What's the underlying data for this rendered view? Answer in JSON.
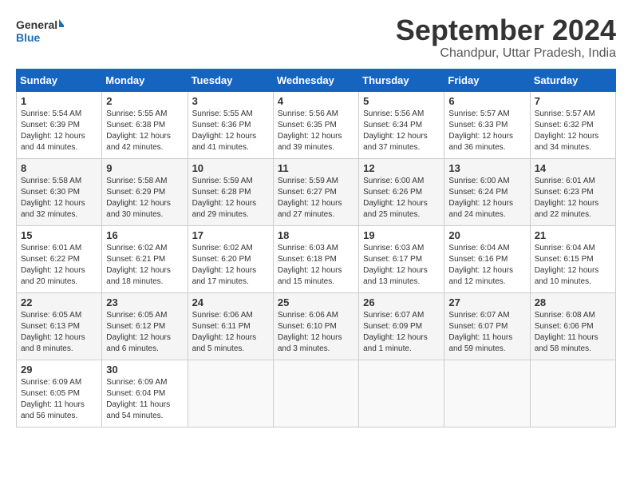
{
  "header": {
    "logo_line1": "General",
    "logo_line2": "Blue",
    "month_title": "September 2024",
    "subtitle": "Chandpur, Uttar Pradesh, India"
  },
  "weekdays": [
    "Sunday",
    "Monday",
    "Tuesday",
    "Wednesday",
    "Thursday",
    "Friday",
    "Saturday"
  ],
  "weeks": [
    [
      {
        "day": "1",
        "info": "Sunrise: 5:54 AM\nSunset: 6:39 PM\nDaylight: 12 hours\nand 44 minutes."
      },
      {
        "day": "2",
        "info": "Sunrise: 5:55 AM\nSunset: 6:38 PM\nDaylight: 12 hours\nand 42 minutes."
      },
      {
        "day": "3",
        "info": "Sunrise: 5:55 AM\nSunset: 6:36 PM\nDaylight: 12 hours\nand 41 minutes."
      },
      {
        "day": "4",
        "info": "Sunrise: 5:56 AM\nSunset: 6:35 PM\nDaylight: 12 hours\nand 39 minutes."
      },
      {
        "day": "5",
        "info": "Sunrise: 5:56 AM\nSunset: 6:34 PM\nDaylight: 12 hours\nand 37 minutes."
      },
      {
        "day": "6",
        "info": "Sunrise: 5:57 AM\nSunset: 6:33 PM\nDaylight: 12 hours\nand 36 minutes."
      },
      {
        "day": "7",
        "info": "Sunrise: 5:57 AM\nSunset: 6:32 PM\nDaylight: 12 hours\nand 34 minutes."
      }
    ],
    [
      {
        "day": "8",
        "info": "Sunrise: 5:58 AM\nSunset: 6:30 PM\nDaylight: 12 hours\nand 32 minutes."
      },
      {
        "day": "9",
        "info": "Sunrise: 5:58 AM\nSunset: 6:29 PM\nDaylight: 12 hours\nand 30 minutes."
      },
      {
        "day": "10",
        "info": "Sunrise: 5:59 AM\nSunset: 6:28 PM\nDaylight: 12 hours\nand 29 minutes."
      },
      {
        "day": "11",
        "info": "Sunrise: 5:59 AM\nSunset: 6:27 PM\nDaylight: 12 hours\nand 27 minutes."
      },
      {
        "day": "12",
        "info": "Sunrise: 6:00 AM\nSunset: 6:26 PM\nDaylight: 12 hours\nand 25 minutes."
      },
      {
        "day": "13",
        "info": "Sunrise: 6:00 AM\nSunset: 6:24 PM\nDaylight: 12 hours\nand 24 minutes."
      },
      {
        "day": "14",
        "info": "Sunrise: 6:01 AM\nSunset: 6:23 PM\nDaylight: 12 hours\nand 22 minutes."
      }
    ],
    [
      {
        "day": "15",
        "info": "Sunrise: 6:01 AM\nSunset: 6:22 PM\nDaylight: 12 hours\nand 20 minutes."
      },
      {
        "day": "16",
        "info": "Sunrise: 6:02 AM\nSunset: 6:21 PM\nDaylight: 12 hours\nand 18 minutes."
      },
      {
        "day": "17",
        "info": "Sunrise: 6:02 AM\nSunset: 6:20 PM\nDaylight: 12 hours\nand 17 minutes."
      },
      {
        "day": "18",
        "info": "Sunrise: 6:03 AM\nSunset: 6:18 PM\nDaylight: 12 hours\nand 15 minutes."
      },
      {
        "day": "19",
        "info": "Sunrise: 6:03 AM\nSunset: 6:17 PM\nDaylight: 12 hours\nand 13 minutes."
      },
      {
        "day": "20",
        "info": "Sunrise: 6:04 AM\nSunset: 6:16 PM\nDaylight: 12 hours\nand 12 minutes."
      },
      {
        "day": "21",
        "info": "Sunrise: 6:04 AM\nSunset: 6:15 PM\nDaylight: 12 hours\nand 10 minutes."
      }
    ],
    [
      {
        "day": "22",
        "info": "Sunrise: 6:05 AM\nSunset: 6:13 PM\nDaylight: 12 hours\nand 8 minutes."
      },
      {
        "day": "23",
        "info": "Sunrise: 6:05 AM\nSunset: 6:12 PM\nDaylight: 12 hours\nand 6 minutes."
      },
      {
        "day": "24",
        "info": "Sunrise: 6:06 AM\nSunset: 6:11 PM\nDaylight: 12 hours\nand 5 minutes."
      },
      {
        "day": "25",
        "info": "Sunrise: 6:06 AM\nSunset: 6:10 PM\nDaylight: 12 hours\nand 3 minutes."
      },
      {
        "day": "26",
        "info": "Sunrise: 6:07 AM\nSunset: 6:09 PM\nDaylight: 12 hours\nand 1 minute."
      },
      {
        "day": "27",
        "info": "Sunrise: 6:07 AM\nSunset: 6:07 PM\nDaylight: 11 hours\nand 59 minutes."
      },
      {
        "day": "28",
        "info": "Sunrise: 6:08 AM\nSunset: 6:06 PM\nDaylight: 11 hours\nand 58 minutes."
      }
    ],
    [
      {
        "day": "29",
        "info": "Sunrise: 6:09 AM\nSunset: 6:05 PM\nDaylight: 11 hours\nand 56 minutes."
      },
      {
        "day": "30",
        "info": "Sunrise: 6:09 AM\nSunset: 6:04 PM\nDaylight: 11 hours\nand 54 minutes."
      },
      {
        "day": "",
        "info": ""
      },
      {
        "day": "",
        "info": ""
      },
      {
        "day": "",
        "info": ""
      },
      {
        "day": "",
        "info": ""
      },
      {
        "day": "",
        "info": ""
      }
    ]
  ]
}
